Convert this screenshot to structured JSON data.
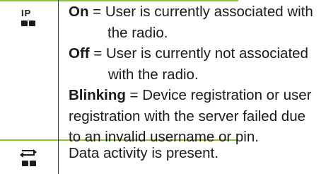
{
  "rows": [
    {
      "icon": "ip-registration-icon",
      "icon_label": "IP",
      "entries": [
        {
          "term": "On",
          "lines": [
            " = User is currently associated with",
            "the radio."
          ]
        },
        {
          "term": "Off",
          "lines": [
            " = User is currently not associated",
            "with the radio."
          ]
        },
        {
          "term": "Blinking",
          "lines": [
            " = Device registration or user",
            "registration with the server failed due",
            "to an invalid username or pin."
          ]
        }
      ]
    },
    {
      "icon": "data-activity-icon",
      "text": "Data activity is present."
    }
  ],
  "colors": {
    "rule": "#8fc33a",
    "divider": "#333333",
    "text": "#1a1a1a"
  }
}
